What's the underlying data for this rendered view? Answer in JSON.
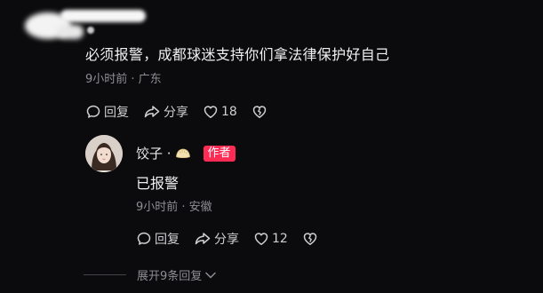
{
  "comment": {
    "text": "必须报警，成都球迷支持你们拿法律保护好自己",
    "meta": "9小时前 · 广东",
    "actions": {
      "reply_label": "回复",
      "share_label": "分享",
      "likes": "18"
    }
  },
  "reply": {
    "author": "饺子 ·",
    "author_badge": "作者",
    "text": "已报警",
    "meta": "9小时前 · 安徽",
    "actions": {
      "reply_label": "回复",
      "share_label": "分享",
      "likes": "12"
    }
  },
  "expand": {
    "label": "展开9条回复"
  },
  "colors": {
    "background": "#0b0b0d",
    "author_badge": "#fe2c55",
    "meta_text": "#8e8e93"
  }
}
